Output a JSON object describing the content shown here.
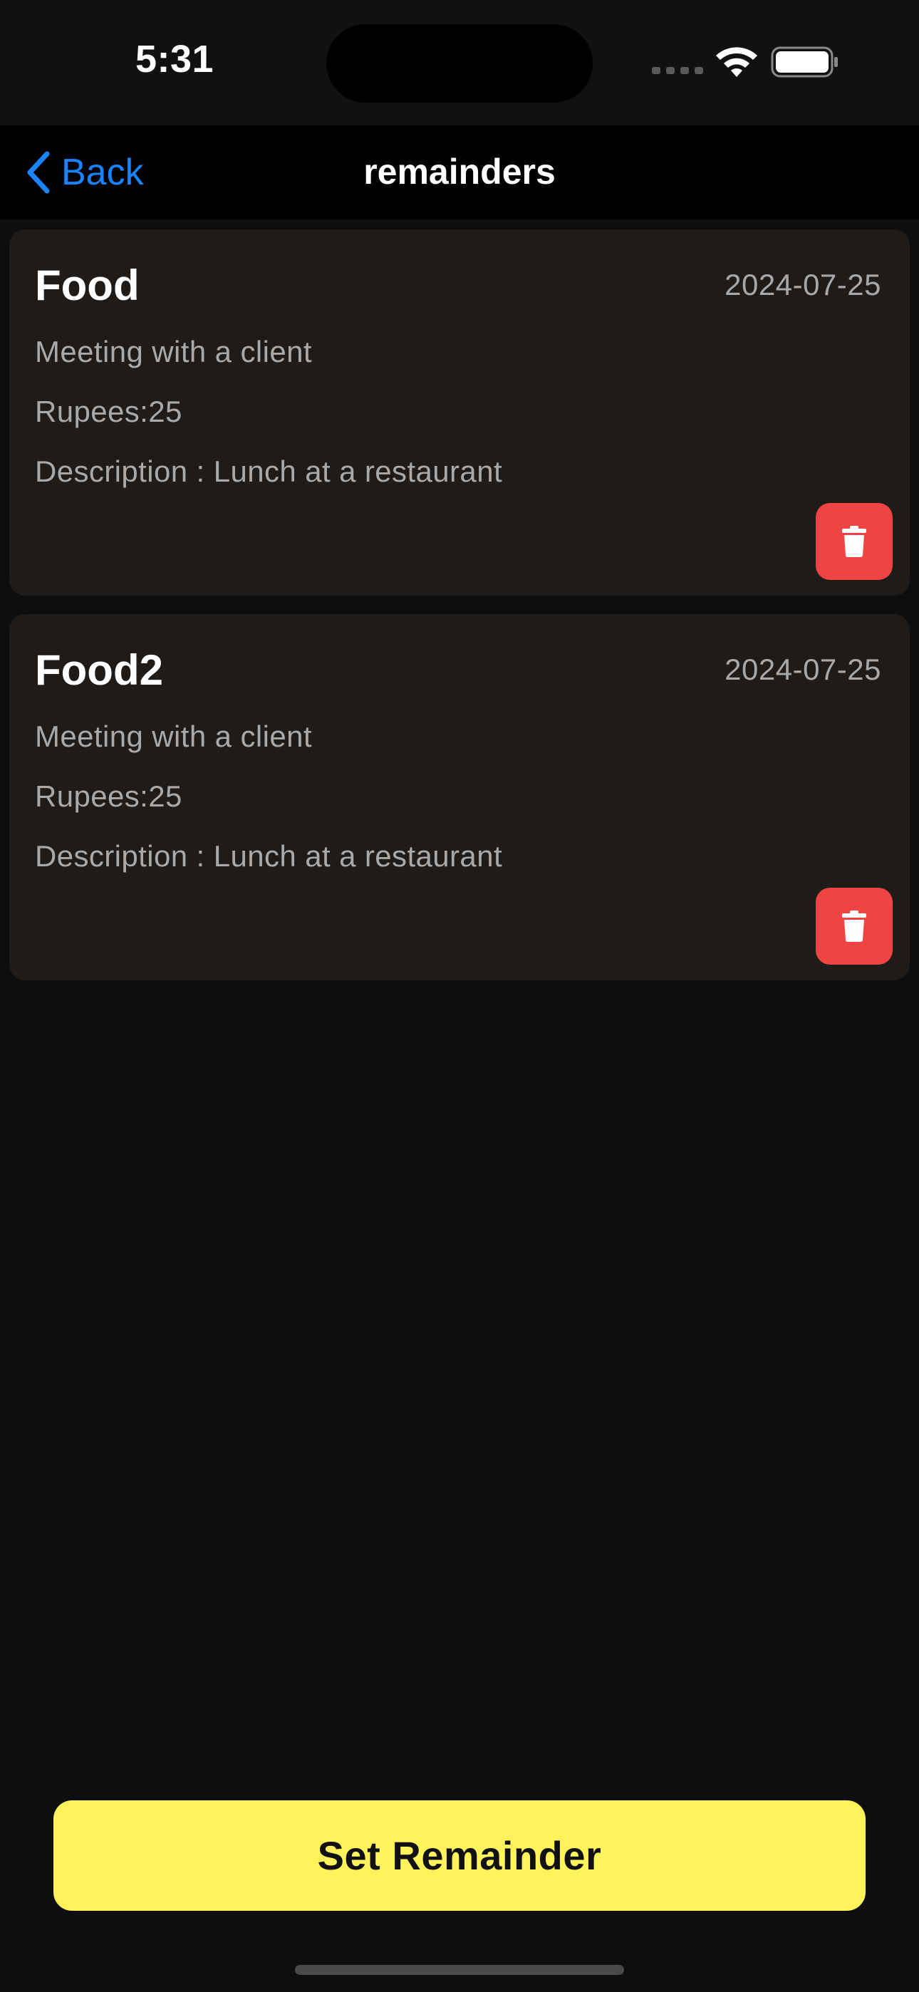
{
  "status_bar": {
    "time": "5:31"
  },
  "nav": {
    "back_label": "Back",
    "title": "remainders"
  },
  "reminders": [
    {
      "title": "Food",
      "date": "2024-07-25",
      "note": "Meeting with a client",
      "amount": "Rupees:25",
      "description": "Description : Lunch at a restaurant"
    },
    {
      "title": "Food2",
      "date": "2024-07-25",
      "note": "Meeting with a client",
      "amount": "Rupees:25",
      "description": "Description : Lunch at a restaurant"
    }
  ],
  "footer": {
    "set_reminder_label": "Set Remainder"
  },
  "colors": {
    "accent_blue": "#1a84ff",
    "delete_red": "#ef4444",
    "primary_yellow": "#fff35c",
    "card_bg": "#1e1b19",
    "screen_bg": "#0e0e0e"
  },
  "icons": {
    "back": "chevron-left-icon",
    "delete": "trash-icon",
    "wifi": "wifi-icon",
    "battery": "battery-icon"
  }
}
